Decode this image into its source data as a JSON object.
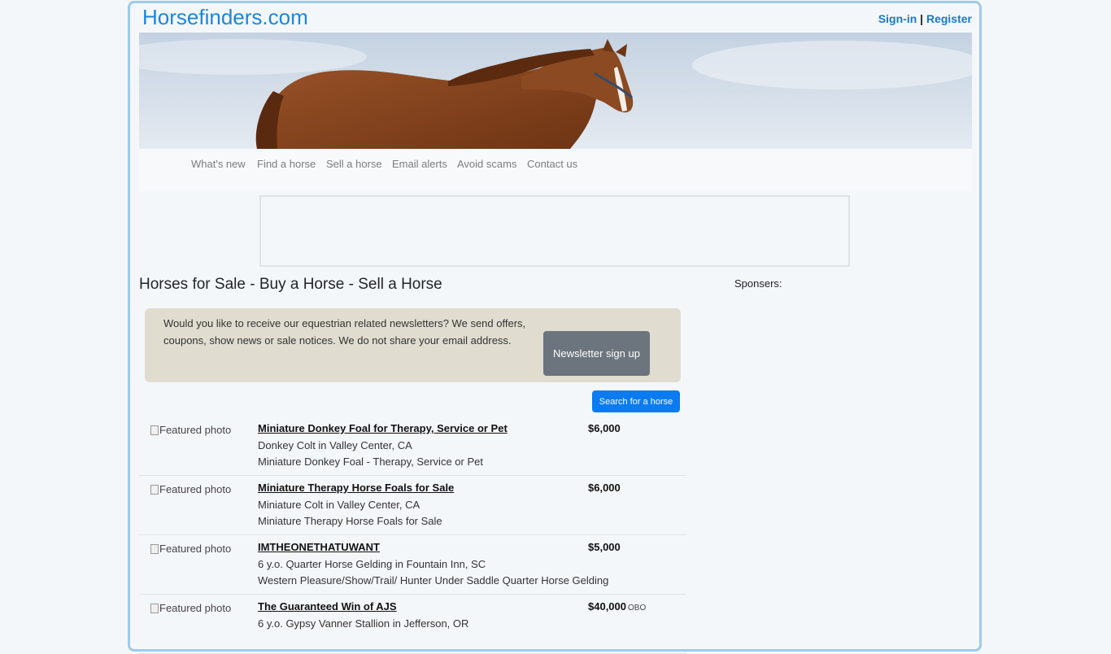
{
  "site": {
    "logo": "Horsefinders.com",
    "signin_label": "Sign-in",
    "separator": "|",
    "register_label": "Register"
  },
  "nav": {
    "items": [
      {
        "label": "What's new"
      },
      {
        "label": "Find a horse"
      },
      {
        "label": "Sell a horse"
      },
      {
        "label": "Email alerts"
      },
      {
        "label": "Avoid scams"
      },
      {
        "label": "Contact us"
      }
    ]
  },
  "main": {
    "title": "Horses for Sale - Buy a Horse - Sell a Horse",
    "sponsors_label": "Sponsers:"
  },
  "newsletter": {
    "text": "Would you like to receive our equestrian related newsletters?  We send offers, coupons, show news or sale notices.  We do not share your email address.",
    "button_label": "Newsletter sign up"
  },
  "search_button_label": "Search for a horse",
  "listings": [
    {
      "photo_alt": "Featured photo",
      "name": "Miniature Donkey Foal for Therapy, Service or Pet",
      "line2": "Donkey Colt in Valley Center, CA",
      "line3": "Miniature Donkey Foal - Therapy, Service or Pet",
      "price": "$6,000",
      "obo": ""
    },
    {
      "photo_alt": "Featured photo",
      "name": "Miniature Therapy Horse Foals for Sale",
      "line2": "Miniature Colt in Valley Center, CA",
      "line3": "Miniature Therapy Horse Foals for Sale",
      "price": "$6,000",
      "obo": ""
    },
    {
      "photo_alt": "Featured photo",
      "name": "IMTHEONETHATUWANT",
      "line2": "6 y.o. Quarter Horse Gelding in Fountain Inn, SC",
      "line3": "Western Pleasure/Show/Trail/ Hunter Under Saddle Quarter Horse Gelding",
      "price": "$5,000",
      "obo": ""
    },
    {
      "photo_alt": "Featured photo",
      "name": "The Guaranteed Win of AJS",
      "line2": "6 y.o. Gypsy Vanner Stallion in Jefferson, OR",
      "line3": "",
      "price": "$40,000",
      "obo": "OBO"
    }
  ]
}
